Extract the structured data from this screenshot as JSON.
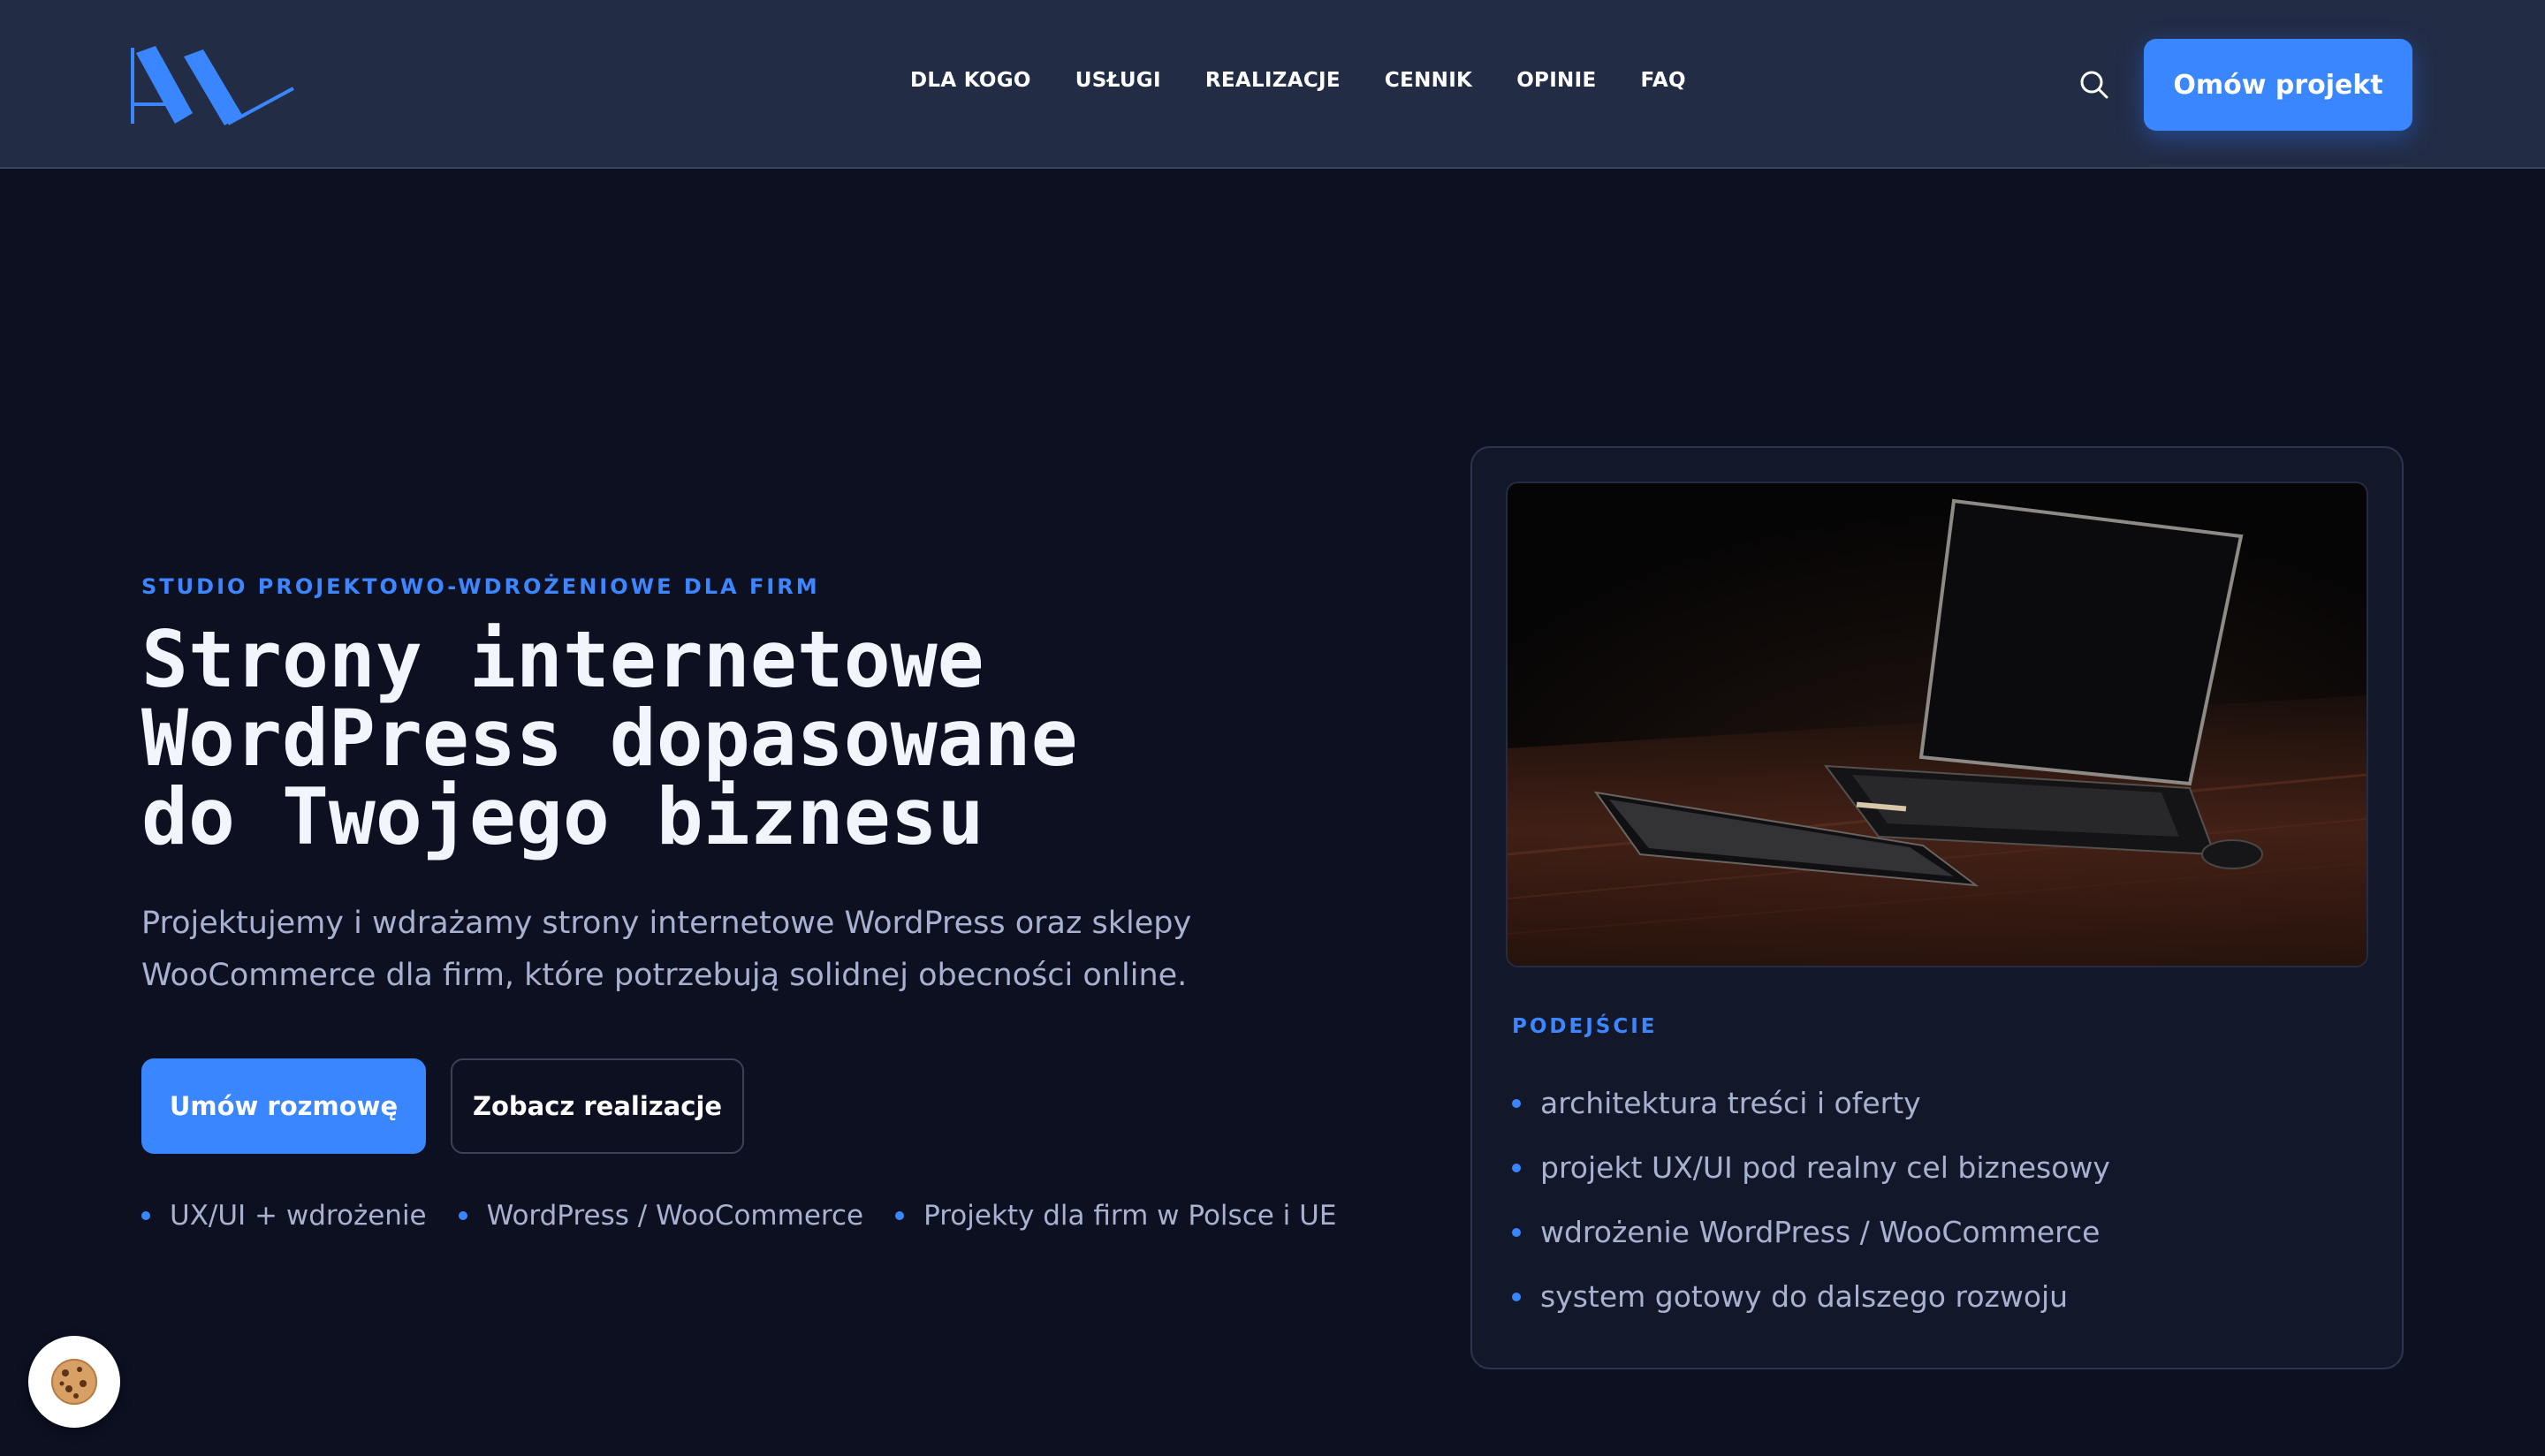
{
  "header": {
    "nav": [
      {
        "label": "DLA KOGO"
      },
      {
        "label": "USŁUGI"
      },
      {
        "label": "REALIZACJE"
      },
      {
        "label": "CENNIK"
      },
      {
        "label": "OPINIE"
      },
      {
        "label": "FAQ"
      }
    ],
    "search_icon": "search-icon",
    "cta_label": "Omów projekt"
  },
  "hero": {
    "eyebrow": "STUDIO PROJEKTOWO-WDROŻENIOWE DLA FIRM",
    "headline": [
      "Strony internetowe",
      "WordPress dopasowane",
      "do Twojego biznesu"
    ],
    "lead": "Projektujemy i wdrażamy strony internetowe WordPress oraz sklepy WooCommerce dla firm, które potrzebują solidnej obecności online.",
    "primary_button": "Umów rozmowę",
    "secondary_button": "Zobacz realizacje",
    "tags": [
      "UX/UI + wdrożenie",
      "WordPress / WooCommerce",
      "Projekty dla firm w Polsce i UE"
    ]
  },
  "card": {
    "label": "PODEJŚCIE",
    "items": [
      "architektura treści i oferty",
      "projekt UX/UI pod realny cel biznesowy",
      "wdrożenie WordPress / WooCommerce",
      "system gotowy do dalszego rozwoju"
    ]
  },
  "colors": {
    "accent": "#3a86ff",
    "header_bg": "#232c45",
    "page_bg": "#0c1021",
    "muted_text": "#a8b2d0"
  },
  "cookie_icon": "cookie-icon"
}
